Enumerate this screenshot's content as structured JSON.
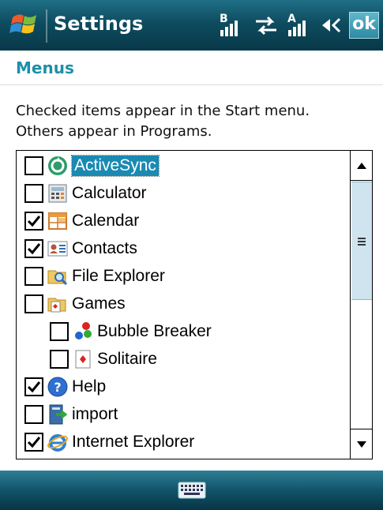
{
  "window": {
    "title": "Settings",
    "ok_label": "ok",
    "status_icons": [
      "start-flag-icon",
      "signal-bluetooth-icon",
      "connectivity-arrows-icon",
      "signal-antenna-icon",
      "volume-icon"
    ]
  },
  "header": {
    "title": "Menus"
  },
  "description": {
    "line1": "Checked items appear in the Start menu.",
    "line2": "Others appear in Programs."
  },
  "list": {
    "items": [
      {
        "label": "ActiveSync",
        "checked": false,
        "icon": "activesync-icon",
        "indent": 0,
        "selected": true
      },
      {
        "label": "Calculator",
        "checked": false,
        "icon": "calculator-icon",
        "indent": 0,
        "selected": false
      },
      {
        "label": "Calendar",
        "checked": true,
        "icon": "calendar-icon",
        "indent": 0,
        "selected": false
      },
      {
        "label": "Contacts",
        "checked": true,
        "icon": "contacts-icon",
        "indent": 0,
        "selected": false
      },
      {
        "label": "File Explorer",
        "checked": false,
        "icon": "file-explorer-icon",
        "indent": 0,
        "selected": false
      },
      {
        "label": "Games",
        "checked": false,
        "icon": "games-icon",
        "indent": 0,
        "selected": false
      },
      {
        "label": "Bubble Breaker",
        "checked": false,
        "icon": "bubble-breaker-icon",
        "indent": 1,
        "selected": false
      },
      {
        "label": "Solitaire",
        "checked": false,
        "icon": "solitaire-icon",
        "indent": 1,
        "selected": false
      },
      {
        "label": "Help",
        "checked": true,
        "icon": "help-icon",
        "indent": 0,
        "selected": false
      },
      {
        "label": "import",
        "checked": false,
        "icon": "import-icon",
        "indent": 0,
        "selected": false
      },
      {
        "label": "Internet Explorer",
        "checked": true,
        "icon": "internet-explorer-icon",
        "indent": 0,
        "selected": false
      }
    ]
  },
  "bottom_bar": {
    "icon": "keyboard-icon"
  },
  "colors": {
    "accent": "#1d8fa8",
    "selection": "#1a8ab3",
    "titlebar": "#0e4c60"
  }
}
